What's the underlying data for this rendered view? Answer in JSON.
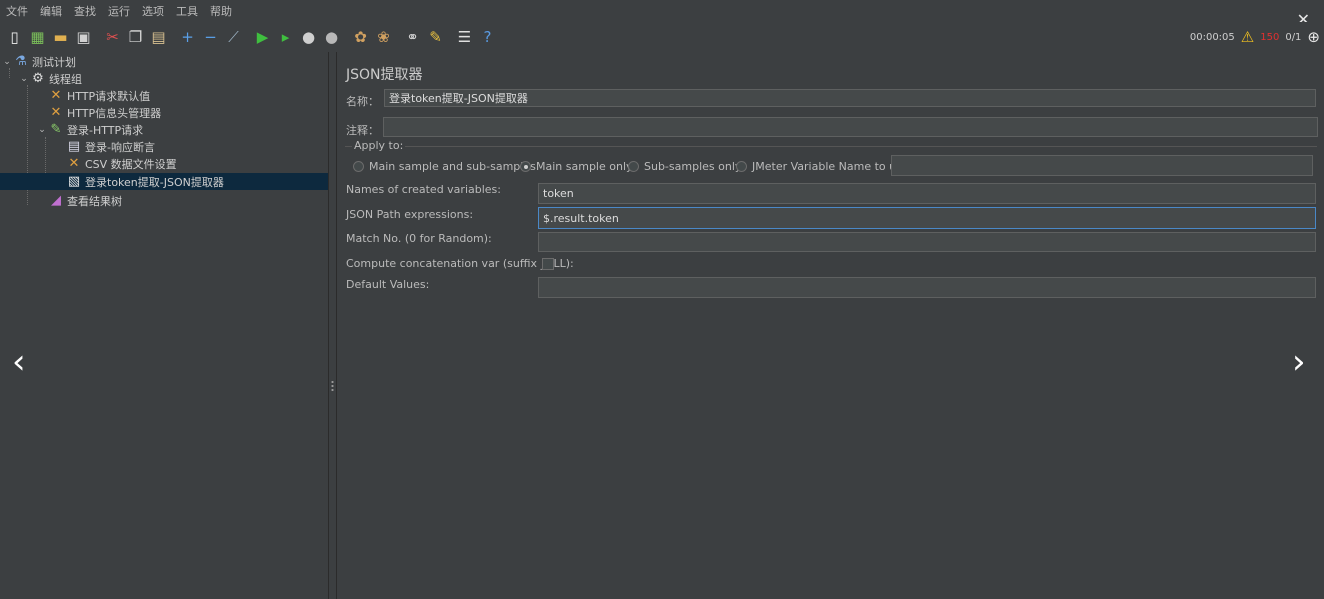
{
  "menu": [
    "文件",
    "编辑",
    "查找",
    "运行",
    "选项",
    "工具",
    "帮助"
  ],
  "toolbar": {
    "icons": [
      "new-icon",
      "templates-icon",
      "open-icon",
      "save-icon",
      "cut-icon",
      "copy-icon",
      "paste-icon",
      "expand-icon",
      "collapse-icon",
      "toggle-icon",
      "start-icon",
      "start-no-pauses-icon",
      "stop-icon",
      "shutdown-icon",
      "clear-icon",
      "clear-all-icon",
      "search-icon",
      "reset-search-icon",
      "function-helper-icon",
      "help-icon"
    ]
  },
  "status": {
    "elapsed": "00:00:05",
    "errors": "150",
    "threads": "0/1"
  },
  "tree": {
    "items": [
      {
        "label": "测试计划",
        "icon": "flask-icon"
      },
      {
        "label": "线程组",
        "icon": "gear-icon"
      },
      {
        "label": "HTTP请求默认值",
        "icon": "wrench-icon"
      },
      {
        "label": "HTTP信息头管理器",
        "icon": "wrench-icon"
      },
      {
        "label": "登录-HTTP请求",
        "icon": "pen-icon"
      },
      {
        "label": "登录-响应断言",
        "icon": "assertion-icon"
      },
      {
        "label": "CSV 数据文件设置",
        "icon": "wrench-icon"
      },
      {
        "label": "登录token提取-JSON提取器",
        "icon": "document-icon"
      },
      {
        "label": "查看结果树",
        "icon": "chart-icon"
      }
    ]
  },
  "panel": {
    "title": "JSON提取器",
    "name_label": "名称：",
    "name_value": "登录token提取-JSON提取器",
    "comment_label": "注释：",
    "comment_value": "",
    "apply_to_label": "Apply to:",
    "apply_options": [
      "Main sample and sub-samples",
      "Main sample only",
      "Sub-samples only",
      "JMeter Variable Name to use"
    ],
    "apply_selected": "Main sample only",
    "jmeter_var_value": "",
    "var_names_label": "Names of created variables:",
    "var_names_value": "token",
    "json_path_label": "JSON Path expressions:",
    "json_path_value": "$.result.token",
    "match_no_label": "Match No. (0 for Random):",
    "match_no_value": "",
    "concat_label": "Compute concatenation var (suffix _ALL):",
    "default_label": "Default Values:",
    "default_value": ""
  }
}
